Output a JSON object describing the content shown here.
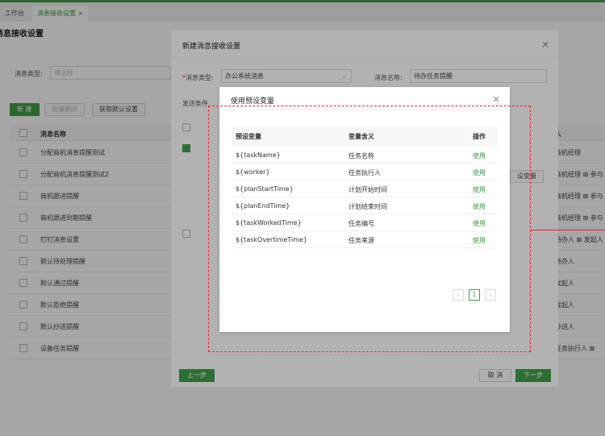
{
  "tabs": [
    {
      "label": "工作台"
    },
    {
      "label": "消息接收设置"
    }
  ],
  "page": {
    "title": "消息接收设置"
  },
  "filter": {
    "label": "消息类型:",
    "placeholder": "请选择"
  },
  "toolbar": {
    "new_label": "新 建",
    "batch_delete_label": "批量删除",
    "get_default_label": "获取默认设置"
  },
  "table": {
    "header": "消息名称",
    "right_header": "人",
    "rows": [
      {
        "name": "分配商机消息提醒测试",
        "right": "商机经理"
      },
      {
        "name": "分配商机消息提醒测试2",
        "right": "商机经理 ⊠ 参与"
      },
      {
        "name": "商机跟进提醒",
        "right": "商机经理 ⊠ 参与"
      },
      {
        "name": "商机跟进到期提醒",
        "right": "商机经理 ⊠ 参与"
      },
      {
        "name": "钉钉消息设置",
        "right": "待办人 ⊠ 发起人"
      },
      {
        "name": "默认待处理提醒",
        "right": "待办人"
      },
      {
        "name": "默认通过提醒",
        "right": "发起人"
      },
      {
        "name": "默认拒绝提醒",
        "right": "发起人"
      },
      {
        "name": "默认抄送提醒",
        "right": "抄送人"
      },
      {
        "name": "设备任务提醒",
        "right": "任务执行人 ⊠"
      }
    ]
  },
  "modal1": {
    "title": "新建消息接收设置",
    "type_label": "消息类型:",
    "type_value": "办公系统消息",
    "name_label": "消息名称:",
    "name_value": "待办任务提醒",
    "send_condition": "发送条件",
    "preset_var_btn": "设变量",
    "prev_label": "上一步",
    "cancel_label": "取 消",
    "next_label": "下一步"
  },
  "modal2": {
    "title": "使用预设变量",
    "columns": {
      "var": "预设变量",
      "meaning": "变量含义",
      "op": "操作"
    },
    "use_label": "使用",
    "rows": [
      {
        "var": "${taskName}",
        "meaning": "任务名称"
      },
      {
        "var": "${worker}",
        "meaning": "任务执行人"
      },
      {
        "var": "${planStartTime}",
        "meaning": "计划开始时间"
      },
      {
        "var": "${planEndTime}",
        "meaning": "计划结束时间"
      },
      {
        "var": "${taskWorkedTime}",
        "meaning": "任务编号"
      },
      {
        "var": "${taskOvertimeTime}",
        "meaning": "任务来源"
      }
    ],
    "pagination": {
      "current": "1"
    }
  },
  "colors": {
    "accent": "#43a047",
    "annotation": "#e22233"
  }
}
